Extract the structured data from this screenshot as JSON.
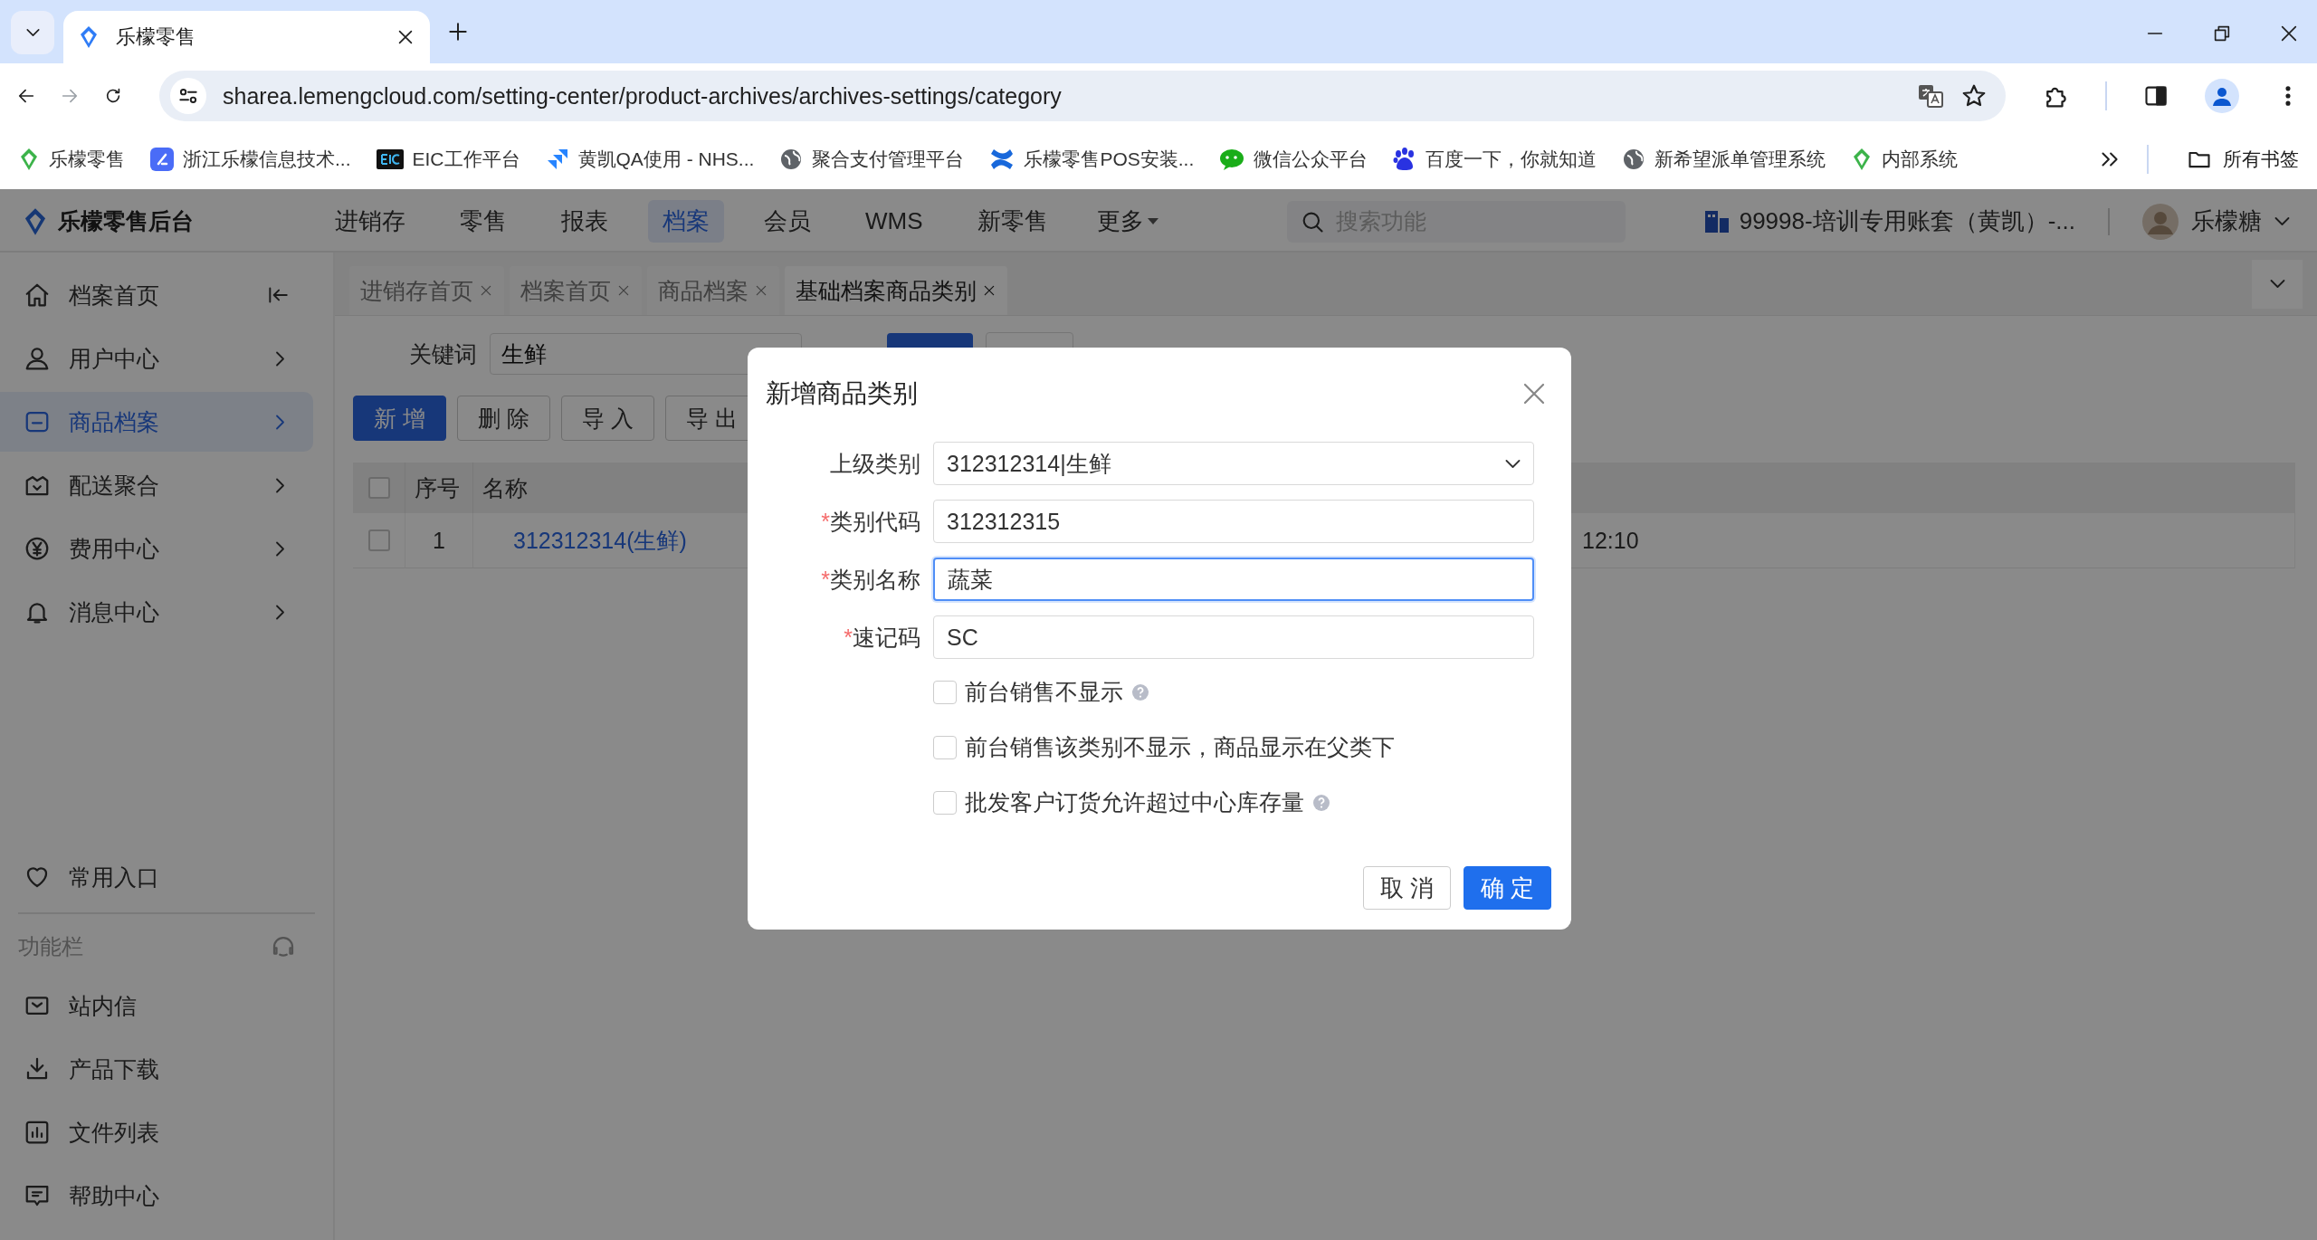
{
  "browser": {
    "tab_title": "乐檬零售",
    "url": "sharea.lemengcloud.com/setting-center/product-archives/archives-settings/category",
    "bookmarks": [
      {
        "label": "乐檬零售",
        "kind": "leaf"
      },
      {
        "label": "浙江乐檬信息技术...",
        "kind": "app"
      },
      {
        "label": "EIC工作平台",
        "kind": "eic"
      },
      {
        "label": "黄凯QA使用 - NHS...",
        "kind": "jira"
      },
      {
        "label": "聚合支付管理平台",
        "kind": "globe"
      },
      {
        "label": "乐檬零售POS安装...",
        "kind": "confluence"
      },
      {
        "label": "微信公众平台",
        "kind": "wechat"
      },
      {
        "label": "百度一下，你就知道",
        "kind": "baidu"
      },
      {
        "label": "新希望派单管理系统",
        "kind": "globe"
      },
      {
        "label": "内部系统",
        "kind": "leaf"
      }
    ],
    "all_bookmarks": "所有书签"
  },
  "app": {
    "brand": "乐檬零售后台",
    "nav": [
      {
        "label": "进销存",
        "selected": false
      },
      {
        "label": "零售",
        "selected": false
      },
      {
        "label": "报表",
        "selected": false
      },
      {
        "label": "档案",
        "selected": true
      },
      {
        "label": "会员",
        "selected": false
      },
      {
        "label": "WMS",
        "selected": false
      },
      {
        "label": "新零售",
        "selected": false
      }
    ],
    "more": "更多",
    "search": {
      "placeholder": "搜索功能"
    },
    "account": "99998-培训专用账套（黄凯）-...",
    "user": "乐檬糖"
  },
  "sidebar": {
    "items": [
      {
        "label": "档案首页",
        "kind": "home",
        "selected": false
      },
      {
        "label": "用户中心",
        "kind": "user",
        "selected": false
      },
      {
        "label": "商品档案",
        "kind": "box",
        "selected": true
      },
      {
        "label": "配送聚合",
        "kind": "bag",
        "selected": false
      },
      {
        "label": "费用中心",
        "kind": "yen",
        "selected": false
      },
      {
        "label": "消息中心",
        "kind": "bell",
        "selected": false
      }
    ],
    "favorites": "常用入口",
    "section_title": "功能栏",
    "tools": [
      {
        "label": "站内信",
        "kind": "mail"
      },
      {
        "label": "产品下载",
        "kind": "download"
      },
      {
        "label": "文件列表",
        "kind": "chart"
      },
      {
        "label": "帮助中心",
        "kind": "chat"
      }
    ]
  },
  "page_tabs": [
    {
      "label": "进销存首页",
      "selected": false
    },
    {
      "label": "档案首页",
      "selected": false
    },
    {
      "label": "商品档案",
      "selected": false
    },
    {
      "label": "基础档案商品类别",
      "selected": true
    }
  ],
  "filter": {
    "label": "关键词",
    "value": "生鲜"
  },
  "actions": [
    {
      "label": "新 增",
      "kind": "primary"
    },
    {
      "label": "删 除",
      "kind": "default"
    },
    {
      "label": "导 入",
      "kind": "default"
    },
    {
      "label": "导 出",
      "kind": "default"
    }
  ],
  "table": {
    "all_checked": false,
    "columns": [
      "序号",
      "名称"
    ],
    "rows": [
      {
        "checked": false,
        "cells": [
          "1",
          "312312314(生鲜)",
          "12:10"
        ]
      }
    ]
  },
  "dialog": {
    "title": "新增商品类别",
    "required_mark": "*",
    "fields": [
      {
        "kind": "select",
        "label": "上级类别",
        "required": false,
        "value": "312312314|生鲜",
        "focused": false
      },
      {
        "kind": "input",
        "label": "类别代码",
        "required": true,
        "value": "312312315",
        "focused": false
      },
      {
        "kind": "input",
        "label": "类别名称",
        "required": true,
        "value": "蔬菜",
        "focused": true
      },
      {
        "kind": "input",
        "label": "速记码",
        "required": true,
        "value": "SC",
        "focused": false
      }
    ],
    "options": [
      {
        "label": "前台销售不显示",
        "checked": false,
        "help": true
      },
      {
        "label": "前台销售该类别不显示，商品显示在父类下",
        "checked": false,
        "help": false
      },
      {
        "label": "批发客户订货允许超过中心库存量",
        "checked": false,
        "help": true
      }
    ],
    "buttons": [
      {
        "label": "取 消",
        "kind": "default"
      },
      {
        "label": "确 定",
        "kind": "primary"
      }
    ]
  }
}
